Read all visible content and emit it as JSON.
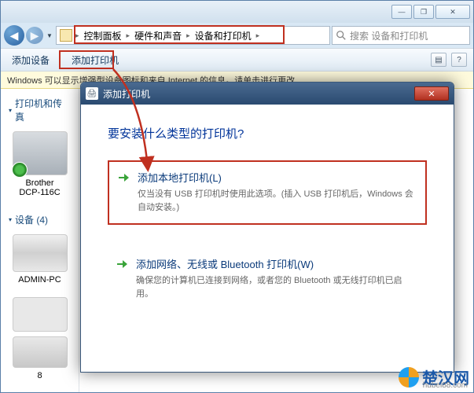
{
  "titlebar": {
    "min": "—",
    "max": "❐",
    "close": "✕"
  },
  "breadcrumb": {
    "items": [
      "控制面板",
      "硬件和声音",
      "设备和打印机"
    ],
    "sep": "▸"
  },
  "search": {
    "placeholder": "搜索 设备和打印机"
  },
  "toolbar": {
    "add_device": "添加设备",
    "add_printer": "添加打印机"
  },
  "infobar": {
    "text": "Windows 可以显示增强型设备图标和来自 Internet 的信息。请单击进行更改..."
  },
  "sidebar": {
    "section_printers": "打印机和传真",
    "printer_name_1": "Brother",
    "printer_name_2": "DCP-116C",
    "section_devices_label": "设备 (4)",
    "device_drive": "ADMIN-PC",
    "device_cam_count": "8"
  },
  "dialog": {
    "title": "添加打印机",
    "heading": "要安装什么类型的打印机?",
    "opt_local_title": "添加本地打印机(L)",
    "opt_local_desc": "仅当没有 USB 打印机时使用此选项。(插入 USB 打印机后，Windows 会自动安装。)",
    "opt_net_title": "添加网络、无线或 Bluetooth 打印机(W)",
    "opt_net_desc": "确保您的计算机已连接到网络，或者您的 Bluetooth 或无线打印机已启用。",
    "close": "✕"
  },
  "watermark": {
    "text": "楚汉网",
    "sub": "hubei88.com"
  }
}
